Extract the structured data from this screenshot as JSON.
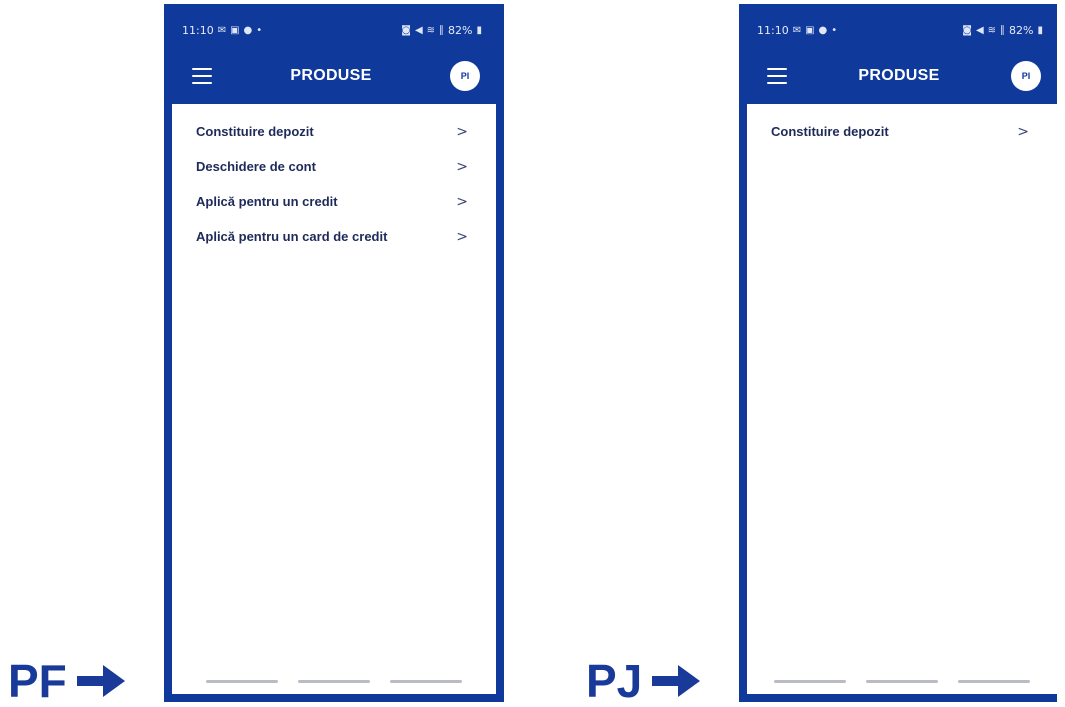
{
  "screens": [
    {
      "id": "pf",
      "caption": "PF",
      "status": {
        "time": "11:10",
        "icons_left": [
          "✉",
          "▣",
          "●",
          "•"
        ],
        "icons_right": [
          "◙",
          "◀",
          "≋",
          "∥"
        ],
        "battery": "82%"
      },
      "app_bar": {
        "title": "PRODUSE",
        "avatar": "PI"
      },
      "items": [
        {
          "label": "Constituire depozit"
        },
        {
          "label": "Deschidere de cont"
        },
        {
          "label": "Aplică pentru un credit"
        },
        {
          "label": "Aplică pentru un card de credit"
        }
      ]
    },
    {
      "id": "pj",
      "caption": "PJ",
      "status": {
        "time": "11:10",
        "icons_left": [
          "✉",
          "▣",
          "●",
          "•"
        ],
        "icons_right": [
          "◙",
          "◀",
          "≋",
          "∥"
        ],
        "battery": "82%"
      },
      "app_bar": {
        "title": "PRODUSE",
        "avatar": "PI"
      },
      "items": [
        {
          "label": "Constituire depozit"
        }
      ]
    }
  ],
  "chevron_glyph": ">",
  "colors": {
    "brand": "#0f3a9c",
    "caption": "#1a3a9a",
    "item_text": "#1e2a5a"
  }
}
